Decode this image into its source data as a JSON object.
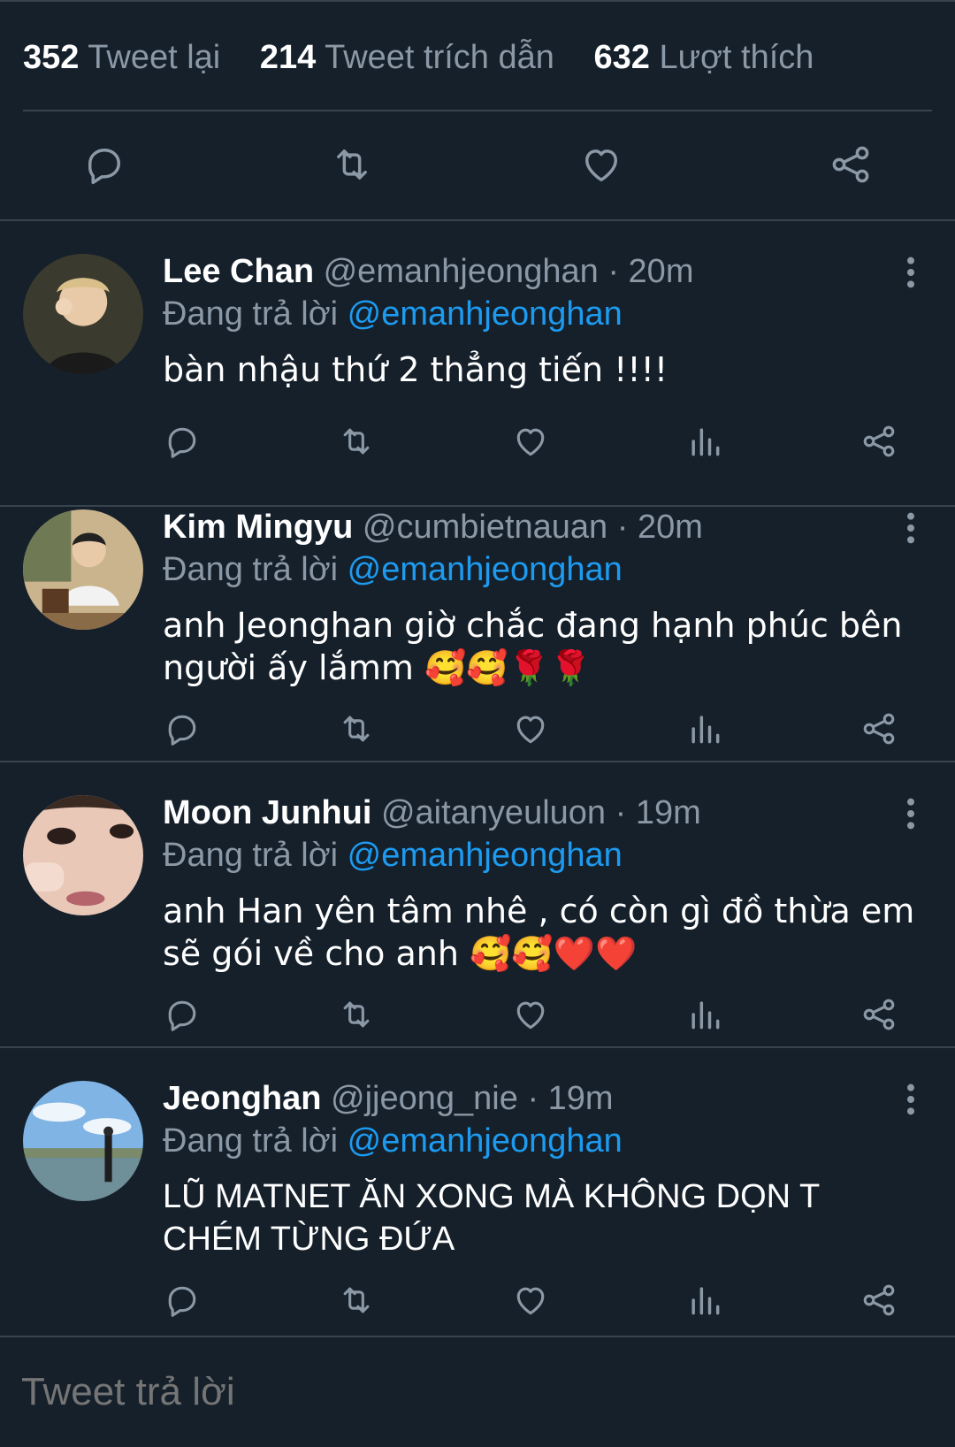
{
  "stats": {
    "retweets": {
      "count": "352",
      "label": "Tweet lại"
    },
    "quotes": {
      "count": "214",
      "label": "Tweet trích dẫn"
    },
    "likes": {
      "count": "632",
      "label": "Lượt thích"
    }
  },
  "main_actions": [
    "reply-icon",
    "retweet-icon",
    "like-icon",
    "share-icon"
  ],
  "replying_prefix": "Đang trả lời",
  "tweets": [
    {
      "name": "Lee Chan",
      "handle": "@emanhjeonghan",
      "dot": "·",
      "time": "20m",
      "reply_to": "@emanhjeonghan",
      "text": "bàn nhậu thứ 2 thẳng tiến !!!!"
    },
    {
      "name": "Kim Mingyu",
      "handle": "@cumbietnauan",
      "dot": "·",
      "time": "20m",
      "reply_to": "@emanhjeonghan",
      "text": "anh Jeonghan giờ chắc đang hạnh phúc bên người ấy lắmm 🥰🥰🌹🌹"
    },
    {
      "name": "Moon Junhui",
      "handle": "@aitanyeuluon",
      "dot": "·",
      "time": "19m",
      "reply_to": "@emanhjeonghan",
      "text": "anh Han yên tâm nhê , có còn gì đồ thừa em sẽ gói về cho anh 🥰🥰❤️❤️"
    },
    {
      "name": "Jeonghan",
      "handle": "@jjeong_nie",
      "dot": "·",
      "time": "19m",
      "reply_to": "@emanhjeonghan",
      "text": "LŨ MATNET ĂN XONG MÀ KHÔNG DỌN T CHÉM TỪNG ĐỨA"
    }
  ],
  "compose": {
    "placeholder": "Tweet trả lời"
  },
  "colors": {
    "background": "#15202b",
    "muted": "#8b98a5",
    "accent": "#1d9bf0",
    "divider": "#38444d"
  }
}
